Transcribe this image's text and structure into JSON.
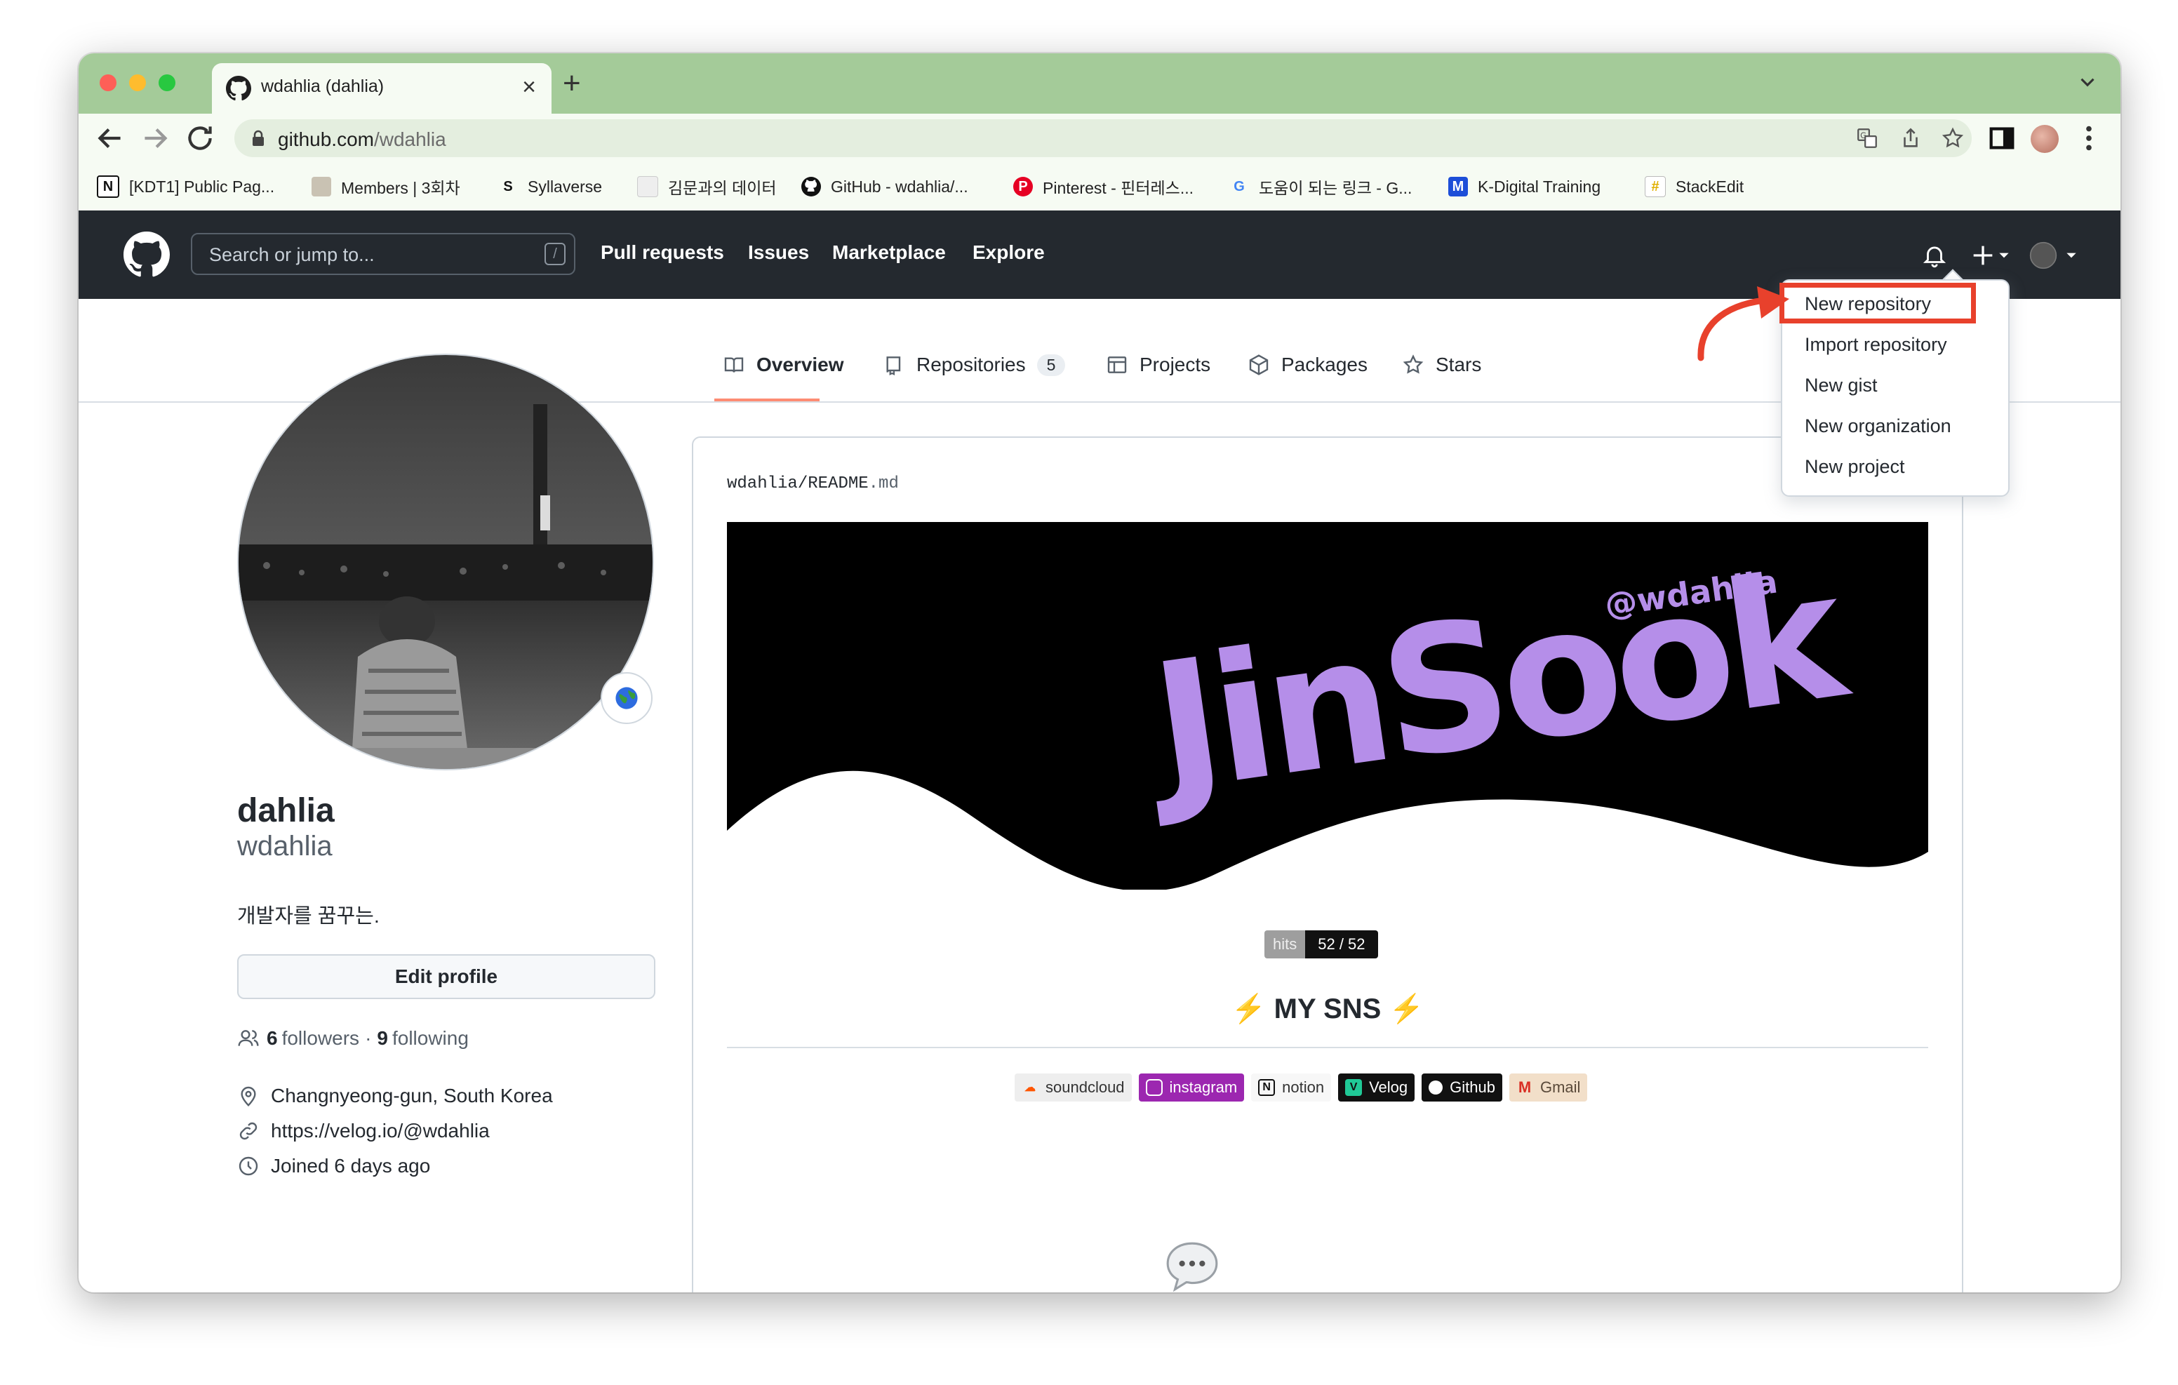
{
  "browser": {
    "tab_title": "wdahlia (dahlia)",
    "url_host": "github.com",
    "url_path": "/wdahlia",
    "bookmarks": [
      {
        "label": "[KDT1] Public Pag...",
        "icon": "notion-icon"
      },
      {
        "label": "Members | 3회차",
        "icon": "slides-icon"
      },
      {
        "label": "Syllaverse",
        "icon": "syllaverse-icon"
      },
      {
        "label": "김문과의 데이터",
        "icon": "blog-icon"
      },
      {
        "label": "GitHub - wdahlia/...",
        "icon": "github-icon"
      },
      {
        "label": "Pinterest - 핀터레스...",
        "icon": "pinterest-icon"
      },
      {
        "label": "도움이 되는 링크 - G...",
        "icon": "google-icon"
      },
      {
        "label": "K-Digital Training",
        "icon": "kdigital-icon"
      },
      {
        "label": "StackEdit",
        "icon": "stackedit-icon"
      }
    ]
  },
  "github_header": {
    "search_placeholder": "Search or jump to...",
    "search_key": "/",
    "nav": [
      "Pull requests",
      "Issues",
      "Marketplace",
      "Explore"
    ]
  },
  "profile_tabs": [
    {
      "label": "Overview"
    },
    {
      "label": "Repositories",
      "count": "5"
    },
    {
      "label": "Projects"
    },
    {
      "label": "Packages"
    },
    {
      "label": "Stars"
    }
  ],
  "profile": {
    "name": "dahlia",
    "login": "wdahlia",
    "bio": "개발자를 꿈꾸는.",
    "edit_button": "Edit profile",
    "followers_count": "6",
    "followers_label": "followers",
    "separator": "·",
    "following_count": "9",
    "following_label": "following",
    "location": "Changnyeong-gun, South Korea",
    "website": "https://velog.io/@wdahlia",
    "joined": "Joined 6 days ago"
  },
  "readme": {
    "path_user": "wdahlia",
    "path_sep": "/",
    "path_file": "README",
    "path_ext": ".md",
    "banner_handle": "@wdahlia",
    "banner_name": "JinSook",
    "hits_label": "hits",
    "hits_value": "52 / 52",
    "sns_title": "MY SNS",
    "sns_emoji": "⚡",
    "badges": [
      {
        "label": "soundcloud",
        "bg": "#eeeeee",
        "fg": "#333333"
      },
      {
        "label": "instagram",
        "bg": "#9c27b0",
        "fg": "#ffffff"
      },
      {
        "label": "notion",
        "bg": "#f7f7f7",
        "fg": "#333333"
      },
      {
        "label": "Velog",
        "bg": "#111111",
        "fg": "#ffffff"
      },
      {
        "label": "Github",
        "bg": "#111111",
        "fg": "#ffffff"
      },
      {
        "label": "Gmail",
        "bg": "#f2dfc9",
        "fg": "#5a4a3a"
      }
    ]
  },
  "dropdown": {
    "items": [
      "New repository",
      "Import repository",
      "New gist",
      "New organization",
      "New project"
    ]
  },
  "colors": {
    "tab_strip": "#a4cb99",
    "gh_header": "#24292f",
    "banner_text": "#b58ee9",
    "highlight": "#e8412c",
    "tab_underline": "#fd8c73"
  }
}
